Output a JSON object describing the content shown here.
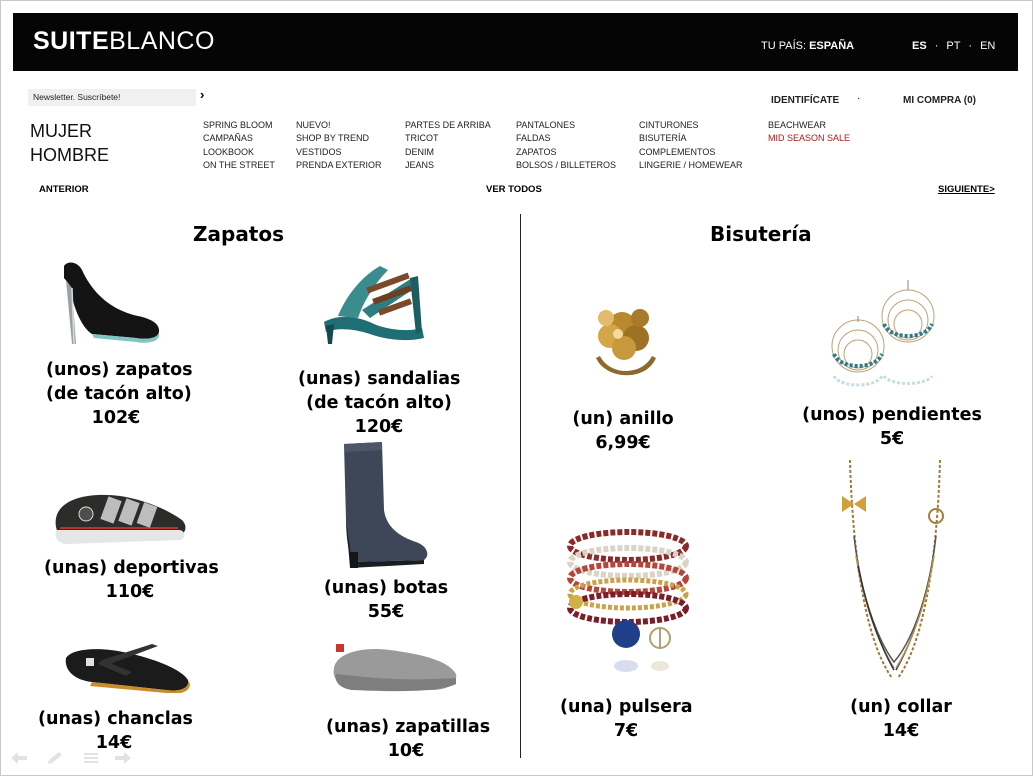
{
  "header": {
    "logo_bold": "SUITE",
    "logo_light": "BLANCO",
    "country_label": "TU PAÍS:",
    "country_value": "ESPAÑA",
    "lang_es": "ES",
    "lang_pt": "PT",
    "lang_en": "EN",
    "lang_sep": "·"
  },
  "subheader": {
    "newsletter": "Newsletter. Suscríbete!",
    "newsletter_arrow": "›",
    "login": "IDENTIFÍCATE",
    "login_sep": "·",
    "cart": "MI COMPRA (0)"
  },
  "gender": {
    "women": "MUJER",
    "men": "HOMBRE"
  },
  "menu": {
    "col1": [
      "SPRING BLOOM",
      "CAMPAÑAS",
      "LOOKBOOK",
      "ON THE STREET"
    ],
    "col2": [
      "NUEVO!",
      "SHOP BY TREND",
      "VESTIDOS",
      "PRENDA EXTERIOR"
    ],
    "col3": [
      "PARTES DE ARRIBA",
      "TRICOT",
      "DENIM",
      "JEANS"
    ],
    "col4": [
      "PANTALONES",
      "FALDAS",
      "ZAPATOS",
      "BOLSOS / BILLETEROS"
    ],
    "col5": [
      "CINTURONES",
      "BISUTERÍA",
      "COMPLEMENTOS",
      "LINGERIE / HOMEWEAR"
    ],
    "col6": [
      "BEACHWEAR",
      "MID SEASON SALE"
    ]
  },
  "pager": {
    "prev": "ANTERIOR",
    "all": "VER TODOS",
    "next": "SIGUIENTE>"
  },
  "sections": {
    "left": "Zapatos",
    "right": "Bisutería"
  },
  "products": {
    "zapatos": {
      "line1": "(unos) zapatos",
      "line2": "(de tacón alto)",
      "price": "102€"
    },
    "sandalias": {
      "line1": "(unas) sandalias",
      "line2": "(de tacón alto)",
      "price": "120€"
    },
    "deportivas": {
      "line1": "(unas) deportivas",
      "price": "110€"
    },
    "botas": {
      "line1": "(unas) botas",
      "price": "55€"
    },
    "chanclas": {
      "line1": "(unas) chanclas",
      "price": "14€"
    },
    "zapatillas": {
      "line1": "(unas) zapatillas",
      "price": "10€"
    },
    "anillo": {
      "line1": "(un) anillo",
      "price": "6,99€"
    },
    "pendientes": {
      "line1": "(unos) pendientes",
      "price": "5€"
    },
    "pulsera": {
      "line1": "(una) pulsera",
      "price": "7€"
    },
    "collar": {
      "line1": "(un) collar",
      "price": "14€"
    }
  },
  "colors": {
    "topbar": "#050505",
    "sale": "#b01818"
  }
}
